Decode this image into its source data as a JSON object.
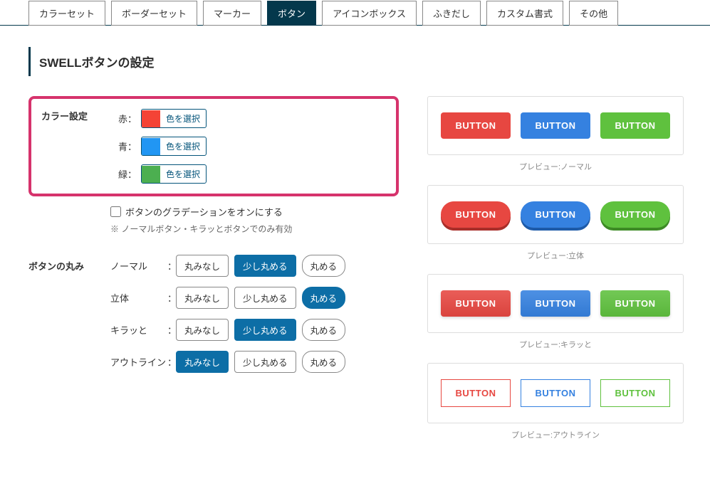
{
  "tabs": [
    {
      "label": "カラーセット",
      "active": false
    },
    {
      "label": "ボーダーセット",
      "active": false
    },
    {
      "label": "マーカー",
      "active": false
    },
    {
      "label": "ボタン",
      "active": true
    },
    {
      "label": "アイコンボックス",
      "active": false
    },
    {
      "label": "ふきだし",
      "active": false
    },
    {
      "label": "カスタム書式",
      "active": false
    },
    {
      "label": "その他",
      "active": false
    }
  ],
  "page_title": "SWELLボタンの設定",
  "color_settings": {
    "heading": "カラー設定",
    "select_label": "色を選択",
    "items": [
      {
        "label": "赤：",
        "swatch": "#f44336"
      },
      {
        "label": "青：",
        "swatch": "#2196f3"
      },
      {
        "label": "緑：",
        "swatch": "#4caf50"
      }
    ],
    "gradient_checkbox": "ボタンのグラデーションをオンにする",
    "gradient_note": "※ ノーマルボタン・キラッとボタンでのみ有効"
  },
  "roundness": {
    "heading": "ボタンの丸み",
    "options": {
      "none": "丸みなし",
      "little": "少し丸める",
      "round": "丸める"
    },
    "rows": [
      {
        "name": "ノーマル",
        "active": "little"
      },
      {
        "name": "立体",
        "active": "round"
      },
      {
        "name": "キラッと",
        "active": "little"
      },
      {
        "name": "アウトライン",
        "active": "none"
      }
    ],
    "colon": "："
  },
  "previews": {
    "button_text": "BUTTON",
    "captions": {
      "normal": "プレビュー:ノーマル",
      "solid": "プレビュー:立体",
      "shiny": "プレビュー:キラッと",
      "outline": "プレビュー:アウトライン"
    }
  }
}
